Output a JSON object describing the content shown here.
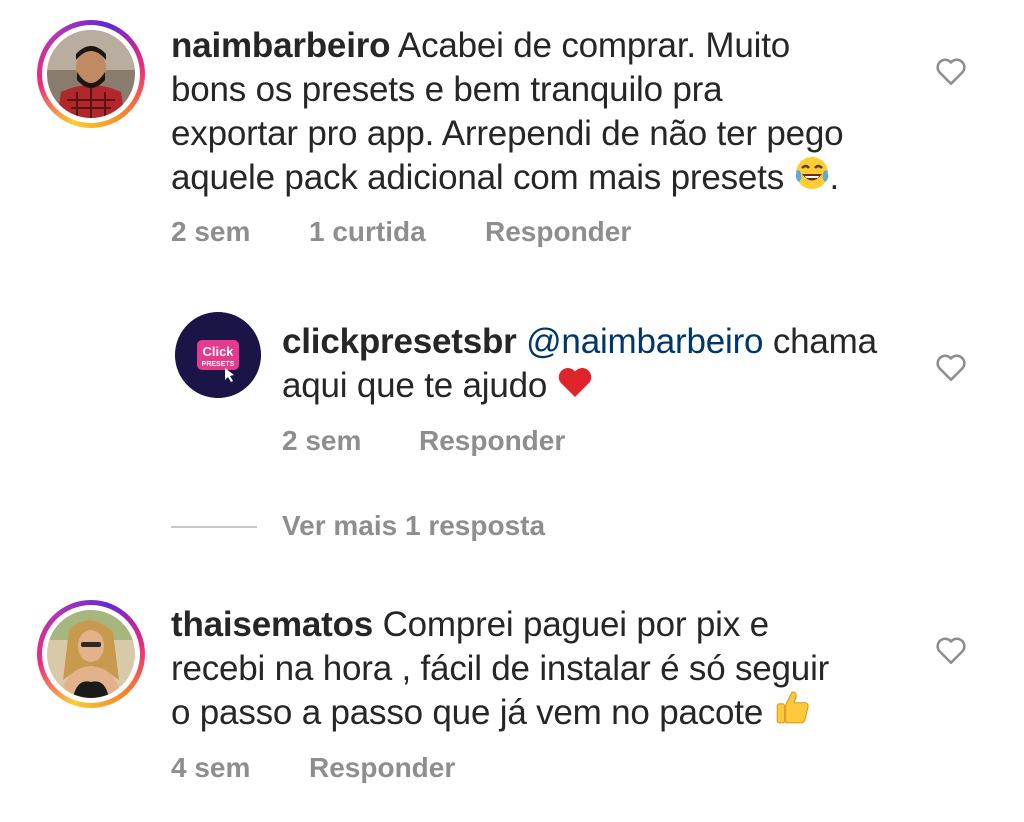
{
  "comments": [
    {
      "username": "naimbarbeiro",
      "lines": [
        "Acabei de comprar. Muito",
        "bons os presets e bem tranquilo pra",
        "exportar pro app. Arrependi de não ter pego",
        "aquele pack adicional com mais presets"
      ],
      "trailing": ".",
      "time": "2 sem",
      "likes": "1 curtida",
      "reply": "Responder"
    },
    {
      "username": "clickpresetsbr",
      "mention": "@naimbarbeiro",
      "line1_rest": "chama",
      "line2": "aqui que te ajudo",
      "time": "2 sem",
      "reply": "Responder",
      "avatar_text_top": "Click",
      "avatar_text_bottom": "PRESETS"
    },
    {
      "username": "thaisematos",
      "lines": [
        "Comprei paguei por pix e",
        "recebi na hora , fácil de instalar é só seguir",
        "o passo a passo que já vem no pacote"
      ],
      "time": "4 sem",
      "reply": "Responder"
    }
  ],
  "view_more": "Ver mais 1 resposta",
  "icons": {
    "like": "heart-outline-icon",
    "emoji_laugh": "tears-of-joy-emoji",
    "emoji_heart": "red-heart-emoji",
    "emoji_thumbs": "thumbs-up-emoji"
  },
  "colors": {
    "text": "#262626",
    "meta": "#8e8e8e",
    "mention": "#00376b",
    "heart": "#e0242c"
  }
}
